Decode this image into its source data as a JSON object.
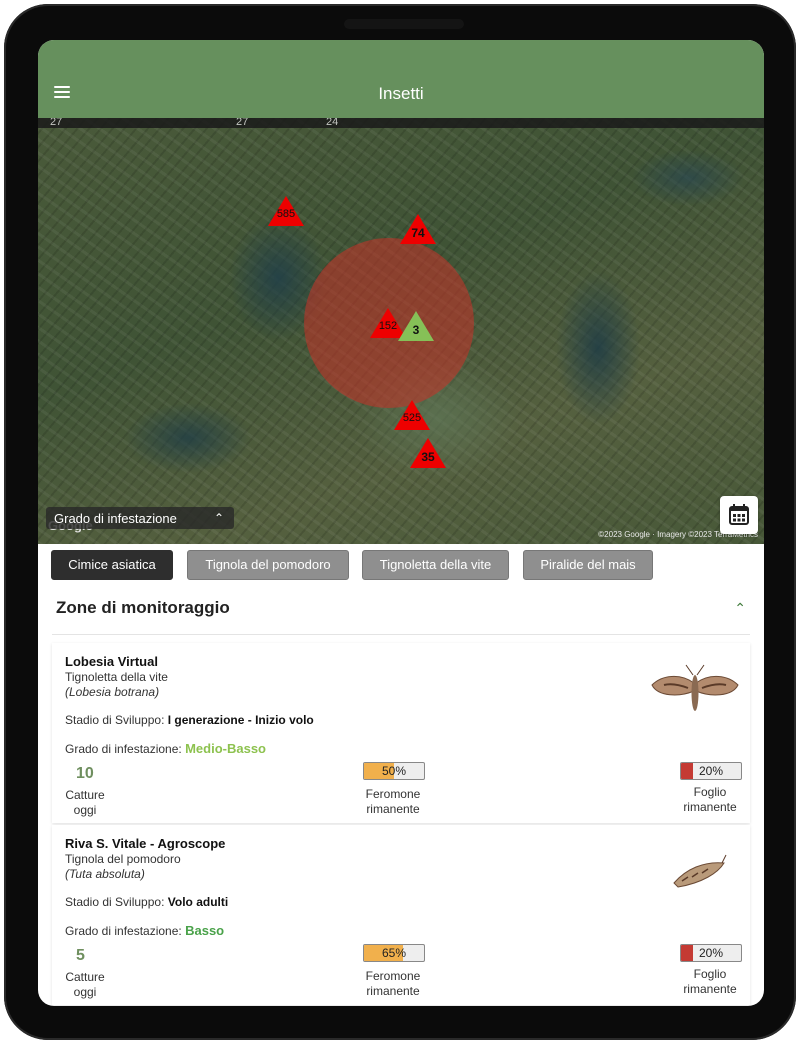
{
  "appbar": {
    "title": "Insetti"
  },
  "map": {
    "top_labels": [
      "27",
      "27",
      "24"
    ],
    "markers": [
      {
        "label": "585",
        "color": "red"
      },
      {
        "label": "74",
        "color": "red"
      },
      {
        "label": "152",
        "color": "red"
      },
      {
        "label": "3",
        "color": "green"
      },
      {
        "label": "525",
        "color": "red"
      },
      {
        "label": "35",
        "color": "red"
      }
    ],
    "google": "Google",
    "copyright": "©2023 Google · Imagery ©2023 TerraMetrics",
    "legend_label": "Grado di infestazione"
  },
  "tabs": [
    {
      "label": "Cimice asiatica",
      "active": true
    },
    {
      "label": "Tignola del pomodoro",
      "active": false
    },
    {
      "label": "Tignoletta della vite",
      "active": false
    },
    {
      "label": "Piralide del mais",
      "active": false
    }
  ],
  "section": {
    "title": "Zone di monitoraggio"
  },
  "cards": [
    {
      "name": "Lobesia Virtual",
      "common": "Tignoletta della vite",
      "scientific": "(Lobesia botrana)",
      "stage_label": "Stadio di Sviluppo:",
      "stage_value": "I generazione - Inizio volo",
      "grade_label": "Grado di infestazione:",
      "grade_value": "Medio-Basso",
      "grade_color": "#8dc24f",
      "count": "10",
      "count_label": "Catture oggi",
      "pheromone": {
        "text": "50%",
        "fraction": 0.5,
        "color": "#f1b04c"
      },
      "pheromone_label": "Feromone rimanente",
      "sheet": {
        "text": "20%",
        "fraction": 0.2,
        "color": "#c43a33"
      },
      "sheet_label": "Foglio rimanente"
    },
    {
      "name": "Riva S. Vitale - Agroscope",
      "common": "Tignola del pomodoro",
      "scientific": "(Tuta absoluta)",
      "stage_label": "Stadio di Sviluppo:",
      "stage_value": "Volo adulti",
      "grade_label": "Grado di infestazione:",
      "grade_value": "Basso",
      "grade_color": "#4aa24a",
      "count": "5",
      "count_label": "Catture oggi",
      "pheromone": {
        "text": "65%",
        "fraction": 0.65,
        "color": "#f1b04c"
      },
      "pheromone_label": "Feromone rimanente",
      "sheet": {
        "text": "20%",
        "fraction": 0.2,
        "color": "#c43a33"
      },
      "sheet_label": "Foglio rimanente"
    }
  ]
}
